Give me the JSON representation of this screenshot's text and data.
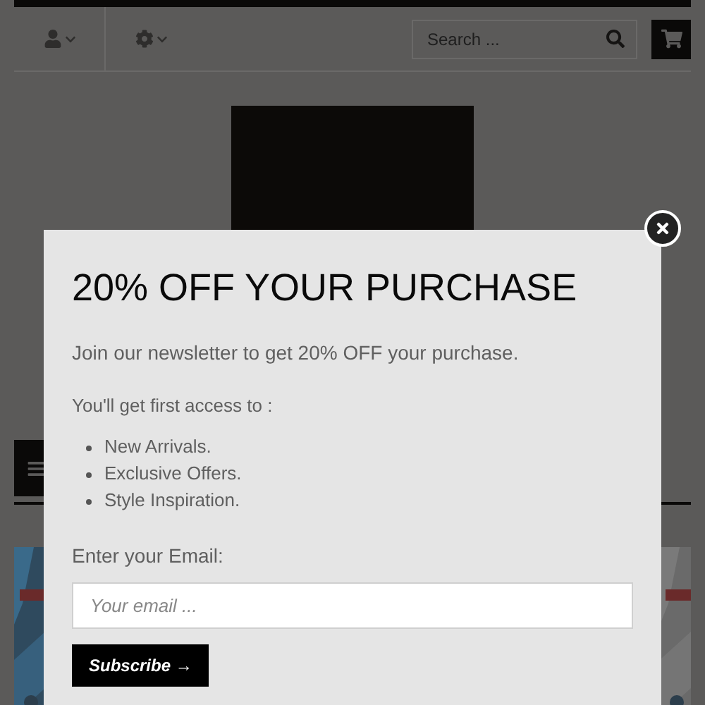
{
  "header": {
    "search": {
      "placeholder": "Search ..."
    }
  },
  "popup": {
    "title": "20% OFF YOUR PURCHASE",
    "intro": "Join our newsletter to get 20% OFF your purchase.",
    "lead": "You'll get first access to :",
    "benefits": [
      "New Arrivals.",
      "Exclusive Offers.",
      "Style Inspiration."
    ],
    "email_label": "Enter your Email:",
    "email": {
      "placeholder": "Your email ..."
    },
    "subscribe": "Subscribe →"
  }
}
